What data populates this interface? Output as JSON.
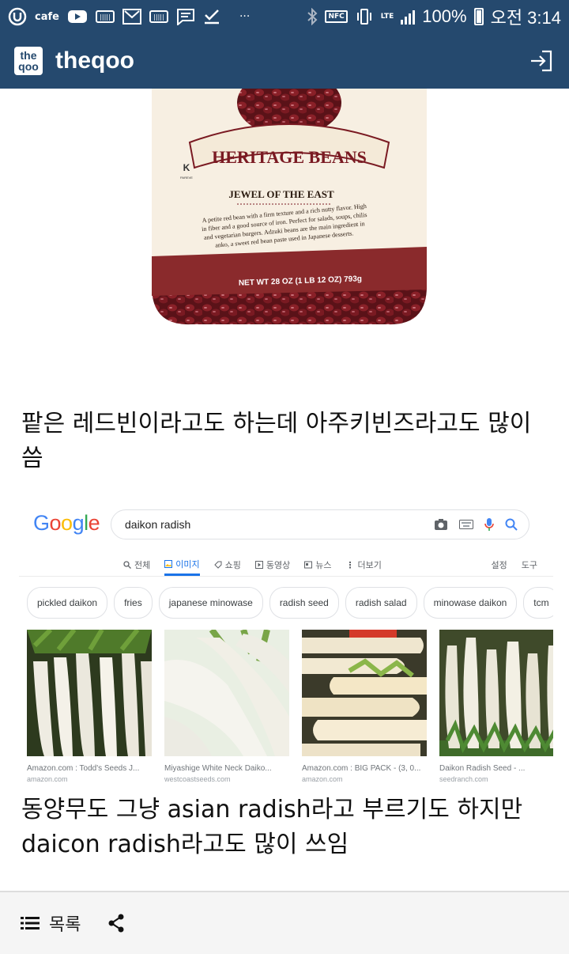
{
  "status_bar": {
    "cafe_label": "cafe",
    "more": "···",
    "nfc": "NFC",
    "lte": "LTE",
    "battery": "100%",
    "time": "오전 3:14"
  },
  "header": {
    "logo_text_top": "the",
    "logo_text_bottom": "qoo",
    "title": "theqoo",
    "login_icon": "login-icon"
  },
  "bean_bag": {
    "brand": "HERITAGE BEANS",
    "name": "JEWEL OF THE EAST",
    "description_lines": [
      "A petite red bean with a firm texture and a rich nutty flavor. High",
      "in fiber and a good source of iron. Perfect for salads, soups, chilis",
      "and vegetarian burgers. Adzuki beans are the main ingredient in",
      "anko, a sweet red bean paste used in Japanese desserts."
    ],
    "net_wt": "NET WT 28 OZ (1 LB 12 OZ) 793g",
    "kosher": "K",
    "kosher_sub": "PAREVE"
  },
  "post": {
    "text_1": "팥은 레드빈이라고도 하는데 아주키빈즈라고도 많이 씀",
    "text_2": "동양무도 그냥 asian radish라고 부르기도 하지만 daicon radish라고도 많이 쓰임"
  },
  "google": {
    "logo_letters": [
      {
        "ch": "G",
        "color": "#4285F4"
      },
      {
        "ch": "o",
        "color": "#EA4335"
      },
      {
        "ch": "o",
        "color": "#FBBC05"
      },
      {
        "ch": "g",
        "color": "#4285F4"
      },
      {
        "ch": "l",
        "color": "#34A853"
      },
      {
        "ch": "e",
        "color": "#EA4335"
      }
    ],
    "query": "daikon radish",
    "tabs": [
      "전체",
      "이미지",
      "쇼핑",
      "동영상",
      "뉴스",
      "더보기"
    ],
    "active_tab": "이미지",
    "settings": "설정",
    "tools": "도구",
    "chips": [
      "pickled daikon",
      "fries",
      "japanese minowase",
      "radish seed",
      "radish salad",
      "minowase daikon",
      "tcm"
    ],
    "results": [
      {
        "source": "Amazon.com : Todd's Seeds J...",
        "domain": "amazon.com"
      },
      {
        "source": "Miyashige White Neck Daiko...",
        "domain": "westcoastseeds.com"
      },
      {
        "source": "Amazon.com : BIG PACK - (3, 0...",
        "domain": "amazon.com"
      },
      {
        "source": "Daikon Radish Seed - ...",
        "domain": "seedranch.com"
      }
    ]
  },
  "bottom_bar": {
    "list_label": "목록"
  }
}
